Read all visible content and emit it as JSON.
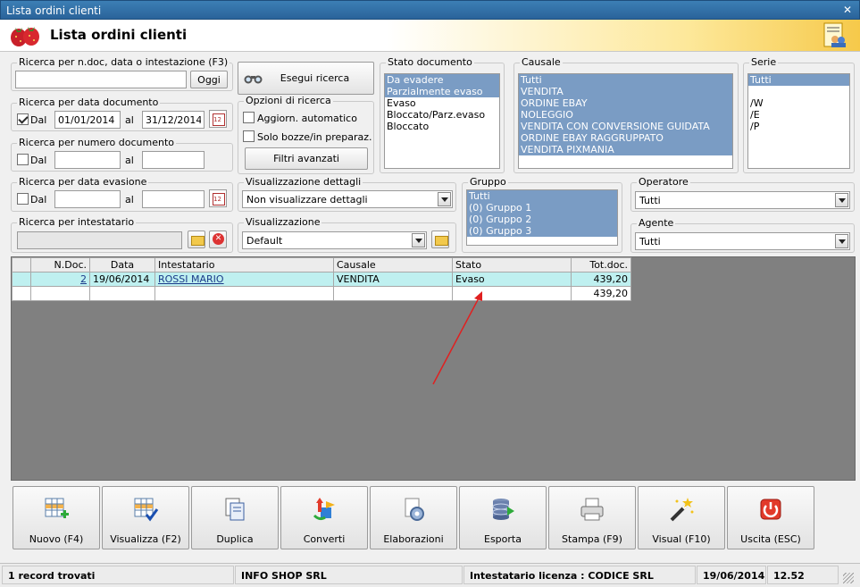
{
  "window": {
    "title": "Lista ordini clienti",
    "close_label": "✕"
  },
  "header": {
    "title": "Lista ordini clienti",
    "logo_icon": "strawberry-icon",
    "user_icon": "users-report-icon"
  },
  "search_ndoc": {
    "legend": "Ricerca per n.doc, data o intestazione (F3)",
    "value": "",
    "button": "Oggi"
  },
  "search_date": {
    "legend": "Ricerca per data documento",
    "dal_label": "Dal",
    "from": "01/01/2014",
    "al_label": "al",
    "to": "31/12/2014",
    "checked": true
  },
  "search_num": {
    "legend": "Ricerca per numero documento",
    "dal_label": "Dal",
    "from": "",
    "al_label": "al",
    "to": ""
  },
  "search_evasione": {
    "legend": "Ricerca per data evasione",
    "dal_label": "Dal",
    "from": "",
    "al_label": "al",
    "to": ""
  },
  "search_intestatario": {
    "legend": "Ricerca per intestatario",
    "value": ""
  },
  "run_search": {
    "label": "Esegui ricerca",
    "icon": "binoculars-icon"
  },
  "options": {
    "legend": "Opzioni di ricerca",
    "auto_update": "Aggiorn. automatico",
    "drafts_only": "Solo bozze/in preparaz.",
    "advanced": "Filtri avanzati"
  },
  "details": {
    "legend": "Visualizzazione dettagli",
    "value": "Non visualizzare dettagli"
  },
  "view": {
    "legend": "Visualizzazione",
    "value": "Default"
  },
  "stato": {
    "legend": "Stato documento",
    "items": [
      {
        "label": "Da evadere",
        "selected": true
      },
      {
        "label": "Parzialmente evaso",
        "selected": true
      },
      {
        "label": "Evaso",
        "selected": false
      },
      {
        "label": "Bloccato/Parz.evaso",
        "selected": false
      },
      {
        "label": "Bloccato",
        "selected": false
      }
    ]
  },
  "causale": {
    "legend": "Causale",
    "items": [
      "Tutti",
      "VENDITA",
      "ORDINE EBAY",
      "NOLEGGIO",
      "VENDITA CON CONVERSIONE GUIDATA",
      "ORDINE EBAY RAGGRUPPATO",
      "VENDITA PIXMANIA"
    ]
  },
  "serie": {
    "legend": "Serie",
    "items": [
      {
        "label": "Tutti",
        "selected": true
      },
      {
        "label": "",
        "selected": false
      },
      {
        "label": "/W",
        "selected": false
      },
      {
        "label": "/E",
        "selected": false
      },
      {
        "label": "/P",
        "selected": false
      }
    ]
  },
  "gruppo": {
    "legend": "Gruppo",
    "items": [
      "Tutti",
      "(0) Gruppo 1",
      "(0) Gruppo 2",
      "(0) Gruppo 3"
    ]
  },
  "operatore": {
    "legend": "Operatore",
    "value": "Tutti"
  },
  "agente": {
    "legend": "Agente",
    "value": "Tutti"
  },
  "table": {
    "columns": [
      "",
      "N.Doc.",
      "Data",
      "Intestatario",
      "Causale",
      "Stato",
      "Tot.doc."
    ],
    "rows": [
      {
        "ndoc": "2",
        "data": "19/06/2014",
        "intestatario": "ROSSI MARIO",
        "causale": "VENDITA",
        "stato": "Evaso",
        "tot": "439,20"
      }
    ],
    "total": "439,20"
  },
  "buttons": [
    {
      "label": "Nuovo (F4)",
      "icon": "new-grid-icon"
    },
    {
      "label": "Visualizza (F2)",
      "icon": "view-grid-icon"
    },
    {
      "label": "Duplica",
      "icon": "duplicate-icon"
    },
    {
      "label": "Converti",
      "icon": "convert-icon"
    },
    {
      "label": "Elaborazioni",
      "icon": "process-gear-icon"
    },
    {
      "label": "Esporta",
      "icon": "export-database-icon"
    },
    {
      "label": "Stampa (F9)",
      "icon": "printer-icon"
    },
    {
      "label": "Visual (F10)",
      "icon": "magic-wand-icon"
    },
    {
      "label": "Uscita (ESC)",
      "icon": "power-icon"
    }
  ],
  "status": {
    "records": "1 record trovati",
    "company": "INFO SHOP SRL",
    "license": "Intestatario licenza : CODICE SRL",
    "date": "19/06/2014",
    "time": "12.52"
  },
  "colors": {
    "selection": "#7a9cc4",
    "current_row": "#bff0f0",
    "grid_bg": "#808080",
    "annotation": "#e02020"
  }
}
